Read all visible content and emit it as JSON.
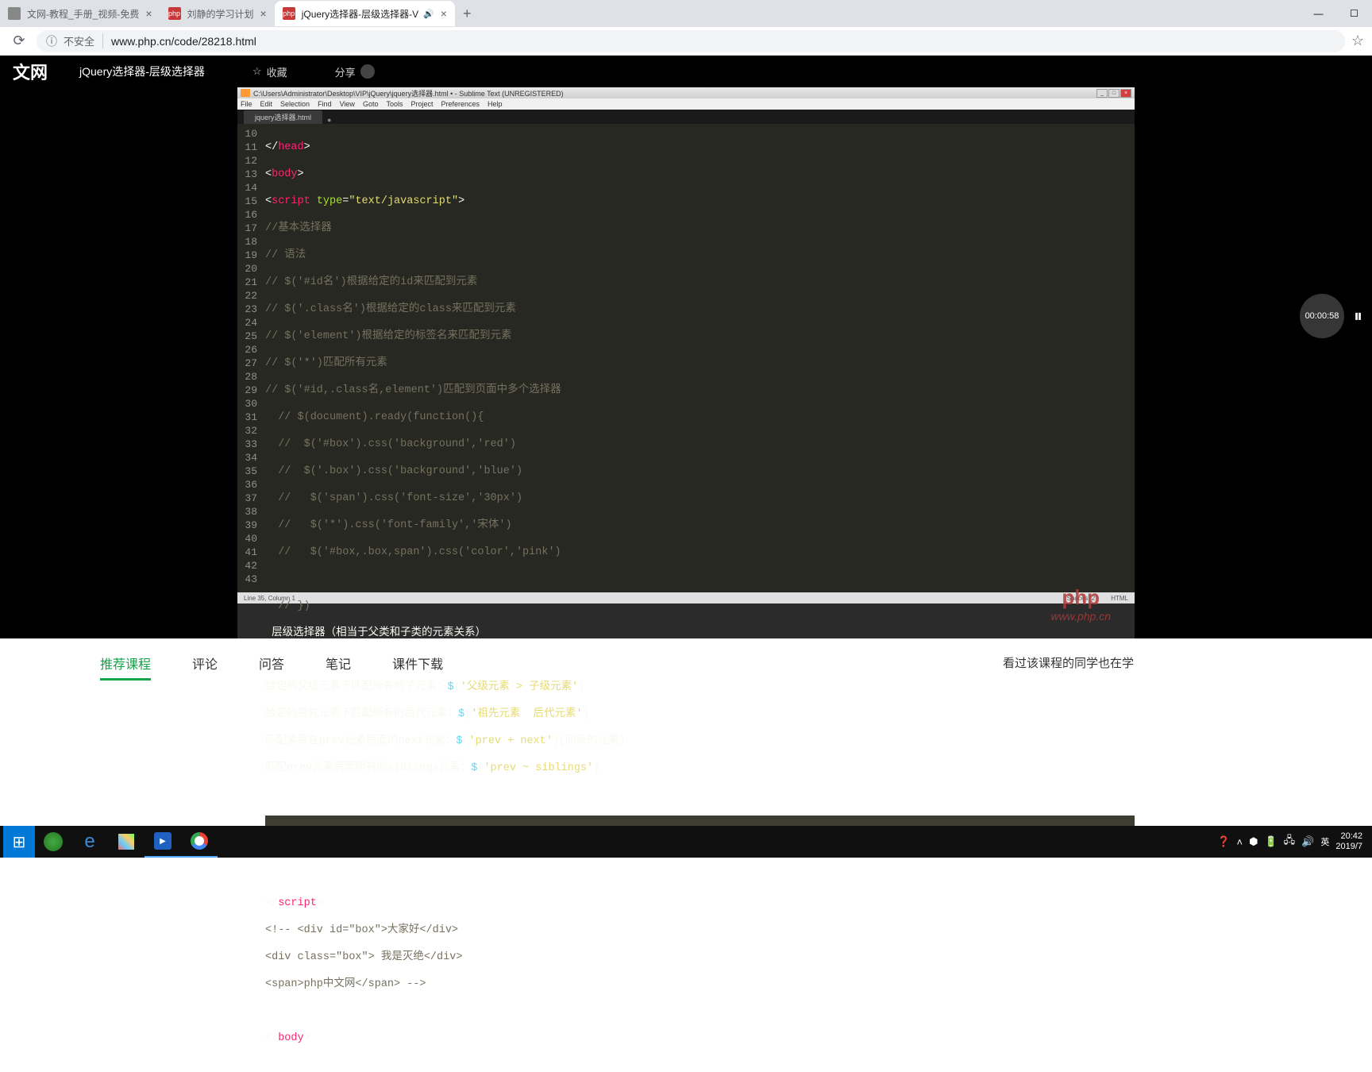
{
  "browser": {
    "tabs": [
      {
        "title": "文网-教程_手册_视频-免费",
        "favicon_bg": "#888",
        "favicon_text": ""
      },
      {
        "title": "刘静的学习计划",
        "favicon_bg": "#c93838",
        "favicon_text": "php"
      },
      {
        "title": "jQuery选择器-层级选择器-V",
        "favicon_bg": "#c93838",
        "favicon_text": "php",
        "audio": "🔊",
        "active": true
      }
    ],
    "new_tab": "+",
    "url": "www.php.cn/code/28218.html",
    "security_label": "不安全",
    "info_icon": "ⓘ",
    "window_min": "—",
    "window_max": "☐",
    "star": "☆"
  },
  "header": {
    "logo": "文网",
    "page_title": "jQuery选择器-层级选择器",
    "favorite": "收藏",
    "favorite_icon": "☆",
    "share": "分享",
    "share_icon": "●"
  },
  "editor": {
    "title": "C:\\Users\\Administrator\\Desktop\\VIP\\jQuery\\jquery选择器.html • - Sublime Text (UNREGISTERED)",
    "menu": [
      "File",
      "Edit",
      "Selection",
      "Find",
      "View",
      "Goto",
      "Tools",
      "Project",
      "Preferences",
      "Help"
    ],
    "tab": "jquery选择器.html",
    "status_left": "Line 35, Column 1",
    "status_spaces": "Spaces: 2",
    "status_lang": "HTML",
    "lines": {
      "l10": {
        "n": "10"
      },
      "l11": {
        "n": "11"
      },
      "l12": {
        "n": "12"
      },
      "l13": {
        "n": "13"
      },
      "l14": {
        "n": "14"
      },
      "l15": {
        "n": "15"
      },
      "l16": {
        "n": "16"
      },
      "l17": {
        "n": "17"
      },
      "l18": {
        "n": "18"
      },
      "l19": {
        "n": "19"
      },
      "l20": {
        "n": "20"
      },
      "l21": {
        "n": "21"
      },
      "l22": {
        "n": "22"
      },
      "l23": {
        "n": "23"
      },
      "l24": {
        "n": "24"
      },
      "l25": {
        "n": "25"
      },
      "l26": {
        "n": "26"
      },
      "l27": {
        "n": "27"
      },
      "l28": {
        "n": "28"
      },
      "l29": {
        "n": "29"
      },
      "l30": {
        "n": "30"
      },
      "l31": {
        "n": "31"
      },
      "l32": {
        "n": "32"
      },
      "l33": {
        "n": "33"
      },
      "l34": {
        "n": "34"
      },
      "l35": {
        "n": "35"
      },
      "l36": {
        "n": "36"
      },
      "l37": {
        "n": "37"
      },
      "l38": {
        "n": "38"
      },
      "l39": {
        "n": "39"
      },
      "l40": {
        "n": "40"
      },
      "l41": {
        "n": "41"
      },
      "l42": {
        "n": "42"
      },
      "l43": {
        "n": "43"
      }
    },
    "code": {
      "c10a": "</",
      "c10b": "head",
      "c10c": ">",
      "c11a": "<",
      "c11b": "body",
      "c11c": ">",
      "c12a": "<",
      "c12b": "script",
      "c12c": " type",
      "c12d": "=",
      "c12e": "\"text/javascript\"",
      "c12f": ">",
      "c13": "//基本选择器",
      "c14": "// 语法",
      "c15": "// $('#id名')根据给定的id来匹配到元素",
      "c16": "// $('.class名')根据给定的class来匹配到元素",
      "c17": "// $('element')根据给定的标签名来匹配到元素",
      "c18": "// $('*')匹配所有元素",
      "c19": "// $('#id,.class名,element')匹配到页面中多个选择器",
      "c20": "  // $(document).ready(function(){",
      "c21": "  //  $('#box').css('background','red')",
      "c22": "  //  $('.box').css('background','blue')",
      "c23": "  //   $('span').css('font-size','30px')",
      "c24": "  //   $('*').css('font-family','宋体')",
      "c25": "  //   $('#box,.box,span').css('color','pink')",
      "c27": "  // })",
      "c28": " 层级选择器（相当于父类和子类的元素关系）",
      "c30a": "给定的父级元素下匹配所有的子元素：",
      "c30b": "$",
      "c30c": "(",
      "c30d": "'父级元素 > 子级元素'",
      "c30e": ")",
      "c31a": "给定的祖先元素下匹配所有的后代元素：",
      "c31b": "$",
      "c31c": "(",
      "c31d": "'祖先元素  后代元素'",
      "c31e": ")",
      "c32a": "匹配紧跟在prev元素后面的next元素：",
      "c32b": "$",
      "c32c": "(",
      "c32d": "'prev + next'",
      "c32e": ")(同级的元素)",
      "c33a": "匹配prev元素后面所有的siblings元素：",
      "c33b": "$",
      "c33c": "(",
      "c33d": "'prev ~ siblings'",
      "c33e": ")",
      "c38a": "</",
      "c38b": "script",
      "c38c": ">",
      "c39": "<!-- <div id=\"box\">大家好</div>",
      "c40": "<div class=\"box\"> 我是灭绝</div>",
      "c41": "<span>php中文网</span> -->",
      "c43a": "</",
      "c43b": "body",
      "c43c": ">"
    }
  },
  "watermark": {
    "brand": "php",
    "url": "www.php.cn"
  },
  "video": {
    "time": "00:00:58",
    "pause": "⏸"
  },
  "bottom_tabs": {
    "recommend": "推荐课程",
    "comments": "评论",
    "qa": "问答",
    "notes": "笔记",
    "download": "课件下载",
    "aside": "看过该课程的同学也在学"
  },
  "taskbar": {
    "time": "20:42",
    "date": "2019/7",
    "ime": "英",
    "tray": [
      "🔊",
      "🖵",
      "🗨",
      "🔋",
      "^"
    ]
  }
}
